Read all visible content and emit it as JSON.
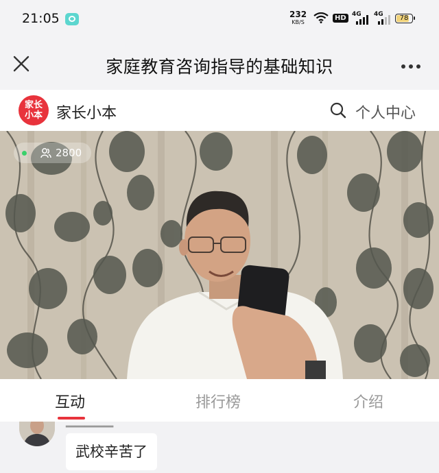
{
  "status_bar": {
    "time": "21:05",
    "net_speed_value": "232",
    "net_speed_unit": "KB/S",
    "hd_label": "HD",
    "signal_1_label": "4G",
    "signal_2_label": "4G",
    "battery_level": "78"
  },
  "header": {
    "title": "家庭教育咨询指导的基础知识"
  },
  "brand": {
    "logo_line1": "家长",
    "logo_line2": "小本",
    "name": "家长小本",
    "user_center_label": "个人中心"
  },
  "live": {
    "viewer_count": "2800"
  },
  "tabs": [
    {
      "label": "互动",
      "active": true
    },
    {
      "label": "排行榜",
      "active": false
    },
    {
      "label": "介绍",
      "active": false
    }
  ],
  "chat": {
    "messages": [
      {
        "text": "武校辛苦了"
      }
    ]
  },
  "colors": {
    "accent": "#e8333c",
    "live_dot": "#3ad06b"
  }
}
